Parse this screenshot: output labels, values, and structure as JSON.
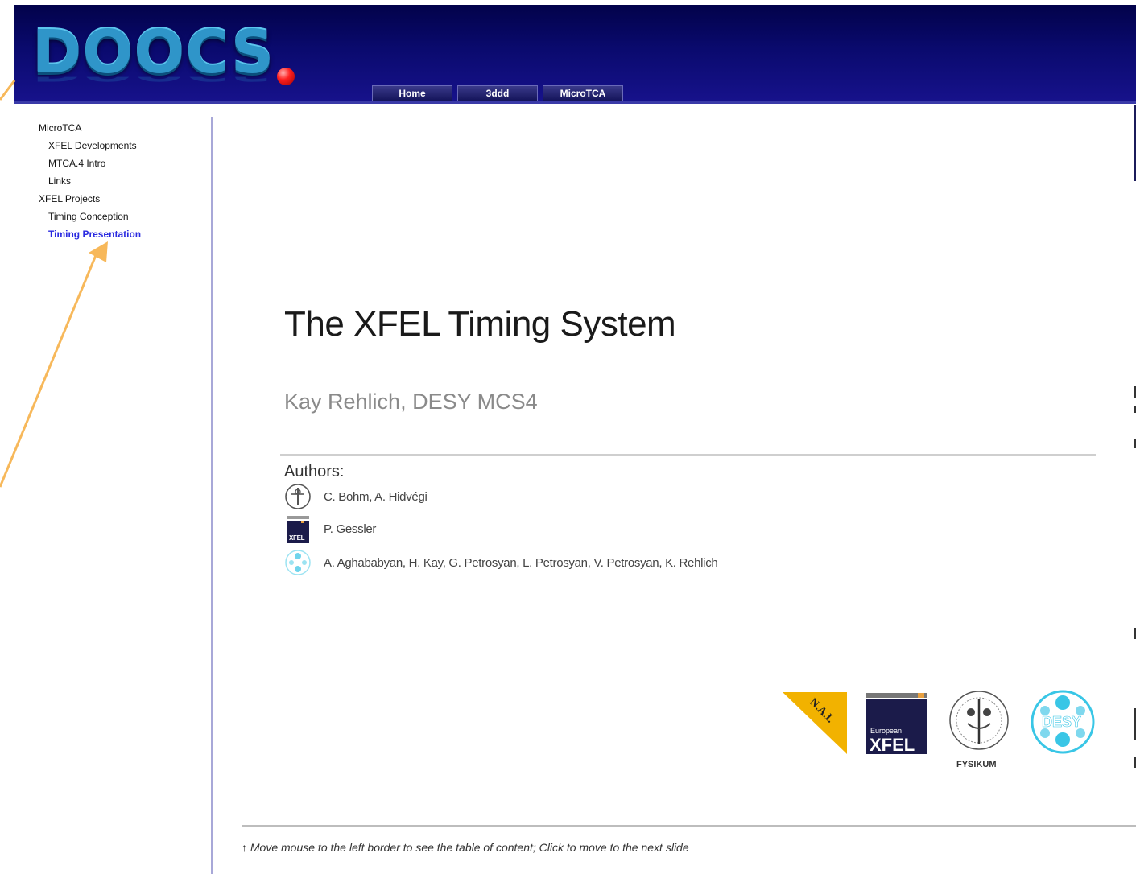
{
  "header": {
    "logo_text": "DOOCS",
    "nav_tabs": [
      {
        "label": "Home"
      },
      {
        "label": "3ddd"
      },
      {
        "label": "MicroTCA"
      }
    ]
  },
  "sidebar": {
    "sections": [
      {
        "title": "MicroTCA",
        "items": [
          "XFEL Developments",
          "MTCA.4 Intro",
          "Links"
        ]
      },
      {
        "title": "XFEL Projects",
        "items": [
          "Timing Conception",
          "Timing Presentation"
        ]
      }
    ],
    "active_item": "Timing Presentation"
  },
  "slide": {
    "title": "The XFEL Timing System",
    "subtitle": "Kay Rehlich, DESY MCS4",
    "authors_label": "Authors:",
    "authors": [
      {
        "names": "C. Bohm, A. Hidvégi",
        "icon": "stockholm-university-seal-icon"
      },
      {
        "names": "P. Gessler",
        "icon": "european-xfel-logo-icon"
      },
      {
        "names": "A. Aghababyan, H. Kay, G. Petrosyan, L. Petrosyan, V. Petrosyan, K. Rehlich",
        "icon": "desy-logo-icon"
      }
    ],
    "logos": {
      "nai": "N.A.I.",
      "xfel_small": "European",
      "xfel_big": "XFEL",
      "fysikum": "FYSIKUM",
      "desy": "DESY"
    }
  },
  "footer": {
    "hint": "↑ Move mouse to the left border to see the table of content; Click to move to the next slide"
  },
  "colors": {
    "banner": "#0a0a6e",
    "active_link": "#2a2ae0",
    "arrow": "#f7b85a",
    "desy": "#39c6e6",
    "nai": "#f2b200"
  }
}
